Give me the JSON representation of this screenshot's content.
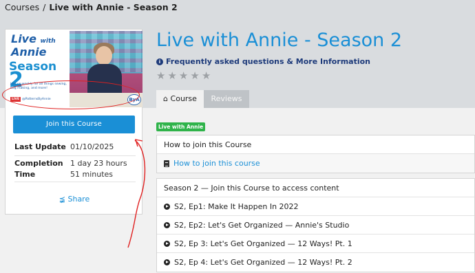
{
  "breadcrumb": {
    "root": "Courses",
    "separator": "/",
    "current": "Live with Annie - Season 2"
  },
  "thumbnail": {
    "live": "Live",
    "with": "with",
    "annie": "Annie",
    "season": "Season",
    "season_num": "2",
    "blurb": "Join us weekly for all things sewing, bag making, and more!",
    "live_badge": "LIVE",
    "handle": "@PatternsByAnnie",
    "logo": "ByA"
  },
  "course_card": {
    "join_button": "Join this Course",
    "last_update_label": "Last Update",
    "last_update_value": "01/10/2025",
    "completion_label": "Completion Time",
    "completion_value": "1 day 23 hours 51 minutes",
    "share_label": "Share"
  },
  "title": "Live with Annie - Season 2",
  "faq_link": "Frequently asked questions & More Information",
  "rating": {
    "stars_filled": 0,
    "stars_total": 5
  },
  "tabs": [
    {
      "label": "Course",
      "active": true
    },
    {
      "label": "Reviews",
      "active": false
    }
  ],
  "tag": "Live with Annie",
  "sections": [
    {
      "title": "How to join this Course",
      "lessons": [
        {
          "label": "How to join this course",
          "type": "doc"
        }
      ]
    },
    {
      "title": "Season 2 — Join this Course to access content",
      "lessons": [
        {
          "label": "S2, Ep1: Make It Happen In 2022",
          "type": "video"
        },
        {
          "label": "S2, Ep2: Let's Get Organized — Annie's Studio",
          "type": "video"
        },
        {
          "label": "S2, Ep 3: Let's Get Organized — 12 Ways! Pt. 1",
          "type": "video"
        },
        {
          "label": "S2, Ep 4: Let's Get Organized — 12 Ways! Pt. 2",
          "type": "video"
        }
      ]
    }
  ],
  "colors": {
    "accent": "#1a8fd6",
    "annotation": "#e02020",
    "tag": "#2fb34a"
  }
}
